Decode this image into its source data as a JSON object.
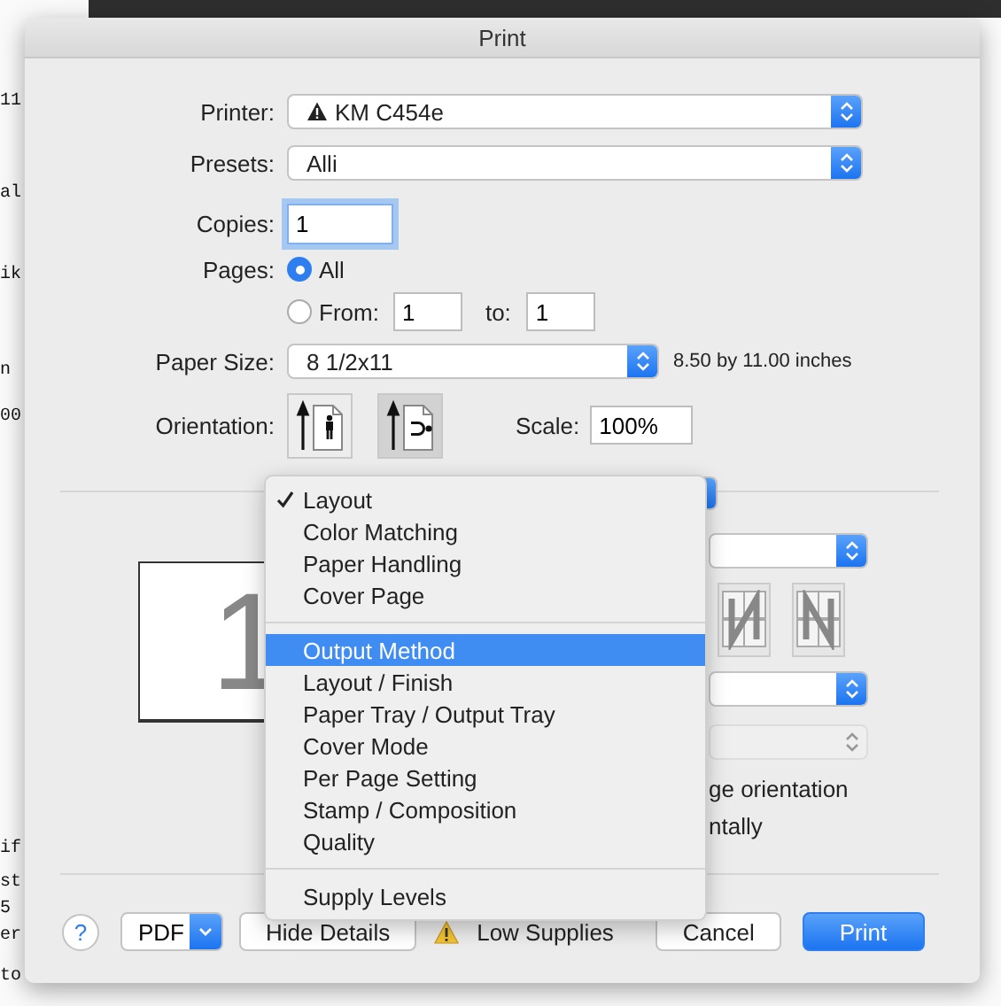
{
  "window": {
    "title": "Print"
  },
  "printer": {
    "label": "Printer:",
    "value": "KM C454e",
    "warning": true
  },
  "presets": {
    "label": "Presets:",
    "value": "Alli"
  },
  "copies": {
    "label": "Copies:",
    "value": "1",
    "focused": true
  },
  "pages": {
    "label": "Pages:",
    "options": [
      {
        "label": "All",
        "selected": true
      },
      {
        "label": "From:",
        "selected": false
      }
    ],
    "from": "1",
    "to_label": "to:",
    "to": "1"
  },
  "paper_size": {
    "label": "Paper Size:",
    "value": "8 1/2x11",
    "note": "8.50 by 11.00 inches"
  },
  "orientation": {
    "label": "Orientation:",
    "options": [
      {
        "kind": "portrait",
        "selected": false
      },
      {
        "kind": "landscape",
        "selected": true
      }
    ]
  },
  "scale": {
    "label": "Scale:",
    "value": "100%"
  },
  "preview": {
    "page_number": "1"
  },
  "layout_panel": {
    "texts": [
      "ge orientation",
      "ntally"
    ]
  },
  "menu": {
    "sections": [
      [
        {
          "label": "Layout",
          "checked": true,
          "selected": false
        },
        {
          "label": "Color Matching",
          "checked": false,
          "selected": false
        },
        {
          "label": "Paper Handling",
          "checked": false,
          "selected": false
        },
        {
          "label": "Cover Page",
          "checked": false,
          "selected": false
        }
      ],
      [
        {
          "label": "Output Method",
          "checked": false,
          "selected": true
        },
        {
          "label": "Layout / Finish",
          "checked": false,
          "selected": false
        },
        {
          "label": "Paper Tray / Output Tray",
          "checked": false,
          "selected": false
        },
        {
          "label": "Cover Mode",
          "checked": false,
          "selected": false
        },
        {
          "label": "Per Page Setting",
          "checked": false,
          "selected": false
        },
        {
          "label": "Stamp / Composition",
          "checked": false,
          "selected": false
        },
        {
          "label": "Quality",
          "checked": false,
          "selected": false
        }
      ],
      [
        {
          "label": "Supply Levels",
          "checked": false,
          "selected": false
        }
      ]
    ]
  },
  "footer": {
    "help": "?",
    "pdf": "PDF",
    "hide_details": "Hide Details",
    "status": "Low Supplies",
    "cancel": "Cancel",
    "print": "Print"
  },
  "background": {
    "fragments": [
      "11",
      "al",
      "ik",
      "n",
      "00",
      "if",
      "st",
      "5",
      "er",
      "to"
    ]
  }
}
